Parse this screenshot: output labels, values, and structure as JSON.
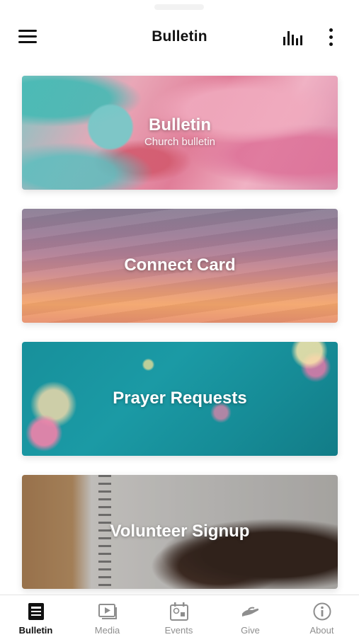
{
  "header": {
    "title": "Bulletin",
    "menu_icon": "hamburger-menu-icon",
    "audio_icon": "audio-bars-icon",
    "more_icon": "more-vertical-icon"
  },
  "cards": [
    {
      "id": "bulletin",
      "title": "Bulletin",
      "subtitle": "Church bulletin"
    },
    {
      "id": "connect",
      "title": "Connect Card"
    },
    {
      "id": "prayer",
      "title": "Prayer Requests"
    },
    {
      "id": "volunteer",
      "title": "Volunteer Signup"
    }
  ],
  "tabs": [
    {
      "label": "Bulletin",
      "icon": "bulletin-icon",
      "active": true
    },
    {
      "label": "Media",
      "icon": "media-play-icon",
      "active": false
    },
    {
      "label": "Events",
      "icon": "events-calendar-icon",
      "active": false
    },
    {
      "label": "Give",
      "icon": "give-hand-icon",
      "active": false
    },
    {
      "label": "About",
      "icon": "info-icon",
      "active": false
    }
  ],
  "colors": {
    "active_tab": "#111111",
    "inactive_tab": "#8e8e8e",
    "background": "#ffffff"
  }
}
